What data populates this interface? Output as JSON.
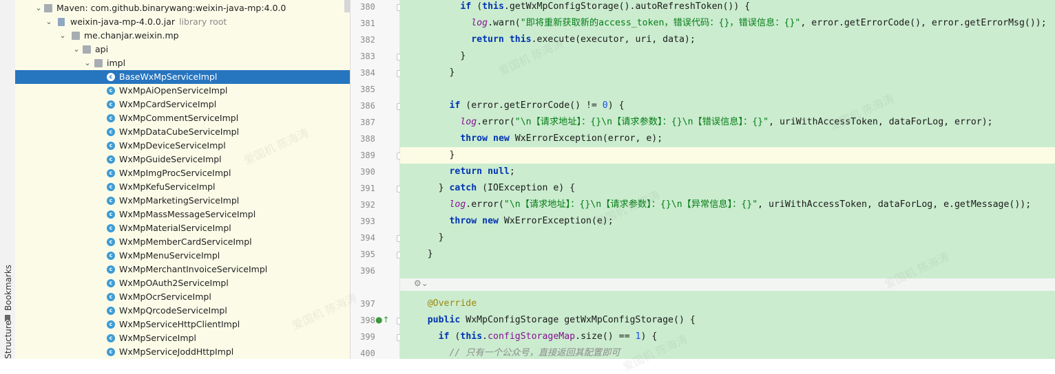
{
  "side_tabs": {
    "bookmarks": "Bookmarks",
    "structure": "Structure"
  },
  "tree": {
    "rows": [
      {
        "label": "Maven: com.github.binarywang:weixin-java-mp:4.0.0",
        "type": "library"
      },
      {
        "label": "weixin-java-mp-4.0.0.jar",
        "suffix": "library root",
        "type": "jar"
      },
      {
        "label": "me.chanjar.weixin.mp",
        "type": "folder"
      },
      {
        "label": "api",
        "type": "folder"
      },
      {
        "label": "impl",
        "type": "folder"
      },
      {
        "label": "BaseWxMpServiceImpl",
        "type": "class",
        "selected": true
      },
      {
        "label": "WxMpAiOpenServiceImpl",
        "type": "class"
      },
      {
        "label": "WxMpCardServiceImpl",
        "type": "class"
      },
      {
        "label": "WxMpCommentServiceImpl",
        "type": "class"
      },
      {
        "label": "WxMpDataCubeServiceImpl",
        "type": "class"
      },
      {
        "label": "WxMpDeviceServiceImpl",
        "type": "class"
      },
      {
        "label": "WxMpGuideServiceImpl",
        "type": "class"
      },
      {
        "label": "WxMpImgProcServiceImpl",
        "type": "class"
      },
      {
        "label": "WxMpKefuServiceImpl",
        "type": "class"
      },
      {
        "label": "WxMpMarketingServiceImpl",
        "type": "class"
      },
      {
        "label": "WxMpMassMessageServiceImpl",
        "type": "class"
      },
      {
        "label": "WxMpMaterialServiceImpl",
        "type": "class"
      },
      {
        "label": "WxMpMemberCardServiceImpl",
        "type": "class"
      },
      {
        "label": "WxMpMenuServiceImpl",
        "type": "class"
      },
      {
        "label": "WxMpMerchantInvoiceServiceImpl",
        "type": "class"
      },
      {
        "label": "WxMpOAuth2ServiceImpl",
        "type": "class"
      },
      {
        "label": "WxMpOcrServiceImpl",
        "type": "class"
      },
      {
        "label": "WxMpQrcodeServiceImpl",
        "type": "class"
      },
      {
        "label": "WxMpServiceHttpClientImpl",
        "type": "class"
      },
      {
        "label": "WxMpServiceImpl",
        "type": "class"
      },
      {
        "label": "WxMpServiceJoddHttpImpl",
        "type": "class"
      }
    ]
  },
  "editor": {
    "lines": [
      {
        "num": "380",
        "tokens": [
          [
            "        ",
            ""
          ],
          [
            "if",
            "kw"
          ],
          [
            " (",
            ""
          ],
          [
            "this",
            "kw"
          ],
          [
            ".getWxMpConfigStorage().autoRefreshToken()) {",
            ""
          ]
        ]
      },
      {
        "num": "381",
        "tokens": [
          [
            "          ",
            ""
          ],
          [
            "log",
            "log"
          ],
          [
            ".warn(",
            ""
          ],
          [
            "\"即将重新获取新的access_token，错误代码：{}，错误信息：{}\"",
            "str"
          ],
          [
            ", error.getErrorCode(), error.getErrorMsg());",
            ""
          ]
        ]
      },
      {
        "num": "382",
        "tokens": [
          [
            "          ",
            ""
          ],
          [
            "return",
            "kw"
          ],
          [
            " ",
            ""
          ],
          [
            "this",
            "kw"
          ],
          [
            ".execute(executor, uri, data);",
            ""
          ]
        ]
      },
      {
        "num": "383",
        "tokens": [
          [
            "        }",
            ""
          ]
        ]
      },
      {
        "num": "384",
        "tokens": [
          [
            "      }",
            ""
          ]
        ]
      },
      {
        "num": "385",
        "tokens": []
      },
      {
        "num": "386",
        "tokens": [
          [
            "      ",
            ""
          ],
          [
            "if",
            "kw"
          ],
          [
            " (error.getErrorCode() != ",
            ""
          ],
          [
            "0",
            "num"
          ],
          [
            ") {",
            ""
          ]
        ]
      },
      {
        "num": "387",
        "tokens": [
          [
            "        ",
            ""
          ],
          [
            "log",
            "log"
          ],
          [
            ".error(",
            ""
          ],
          [
            "\"\\n【请求地址】：{}\\n【请求参数】：{}\\n【错误信息】：{}\"",
            "str"
          ],
          [
            ", uriWithAccessToken, dataForLog, error);",
            ""
          ]
        ]
      },
      {
        "num": "388",
        "tokens": [
          [
            "        ",
            ""
          ],
          [
            "throw",
            "kw"
          ],
          [
            " ",
            ""
          ],
          [
            "new",
            "kw"
          ],
          [
            " WxErrorException(error, e);",
            ""
          ]
        ]
      },
      {
        "num": "389",
        "tokens": [
          [
            "      }",
            ""
          ]
        ],
        "current": true
      },
      {
        "num": "390",
        "tokens": [
          [
            "      ",
            ""
          ],
          [
            "return",
            "kw"
          ],
          [
            " ",
            ""
          ],
          [
            "null",
            "kw"
          ],
          [
            ";",
            ""
          ]
        ]
      },
      {
        "num": "391",
        "tokens": [
          [
            "    } ",
            ""
          ],
          [
            "catch",
            "kw"
          ],
          [
            " (IOException e) {",
            ""
          ]
        ]
      },
      {
        "num": "392",
        "tokens": [
          [
            "      ",
            ""
          ],
          [
            "log",
            "log"
          ],
          [
            ".error(",
            ""
          ],
          [
            "\"\\n【请求地址】：{}\\n【请求参数】：{}\\n【异常信息】：{}\"",
            "str"
          ],
          [
            ", uriWithAccessToken, dataForLog, e.getMessage());",
            ""
          ]
        ]
      },
      {
        "num": "393",
        "tokens": [
          [
            "      ",
            ""
          ],
          [
            "throw",
            "kw"
          ],
          [
            " ",
            ""
          ],
          [
            "new",
            "kw"
          ],
          [
            " WxErrorException(e);",
            ""
          ]
        ]
      },
      {
        "num": "394",
        "tokens": [
          [
            "    }",
            ""
          ]
        ]
      },
      {
        "num": "395",
        "tokens": [
          [
            "  }",
            ""
          ]
        ]
      },
      {
        "num": "396",
        "tokens": []
      },
      {
        "num": "397",
        "tokens": [
          [
            "  ",
            ""
          ],
          [
            "@Override",
            "ann"
          ]
        ]
      },
      {
        "num": "398",
        "tokens": [
          [
            "  ",
            ""
          ],
          [
            "public",
            "kw"
          ],
          [
            " WxMpConfigStorage getWxMpConfigStorage() {",
            ""
          ]
        ]
      },
      {
        "num": "399",
        "tokens": [
          [
            "    ",
            ""
          ],
          [
            "if",
            "kw"
          ],
          [
            " (",
            ""
          ],
          [
            "this",
            "kw"
          ],
          [
            ".",
            ""
          ],
          [
            "configStorageMap",
            "fld"
          ],
          [
            ".size() == ",
            ""
          ],
          [
            "1",
            "num"
          ],
          [
            ") {",
            ""
          ]
        ]
      },
      {
        "num": "400",
        "tokens": [
          [
            "      ",
            ""
          ],
          [
            "// 只有一个公众号，直接返回其配置即可",
            "cmt"
          ]
        ]
      }
    ]
  },
  "watermark": "爱国机 陈海涛"
}
